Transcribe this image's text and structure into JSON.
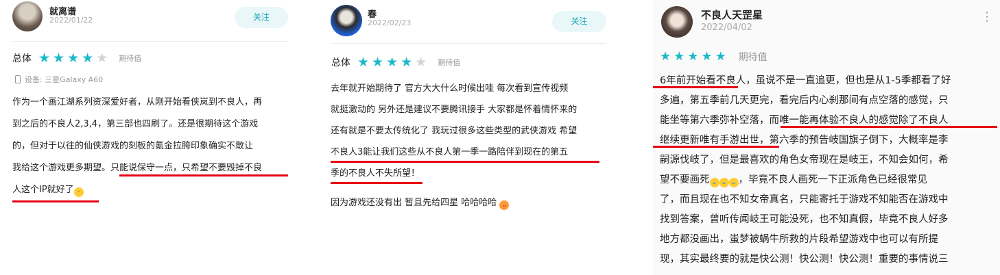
{
  "colors": {
    "star_filled": "#1cb9c8",
    "star_empty": "#d3d3d3",
    "follow_text": "#18a6b9",
    "underline": "#e60012"
  },
  "reviews": [
    {
      "user": "就离谱",
      "date": "2022/01/22",
      "follow_label": "关注",
      "rating_label": "总体",
      "stars_filled": 4,
      "stars_total": 5,
      "expect_label": "期待值",
      "device_icon": "phone-icon",
      "device": "设备: 三星Galaxy A60",
      "lines": [
        "作为一个画江湖系列资深爱好者，从刚开始看侠岚到不良人，再",
        "到之后的不良人2,3,4，第三部也四刷了。还是很期待这个游戏",
        "的，但对于以往的仙侠游戏的刻板的氪金拉胯印象确实不敢让",
        "我给这个游戏更多期望。只能说保守一点，只希望不要毁掉不良",
        "人这个IP就好了"
      ],
      "emoji": "grin-emoji"
    },
    {
      "user": "春",
      "date": "2022/02/23",
      "follow_label": "关注",
      "rating_label": "总体",
      "stars_filled": 4,
      "stars_total": 5,
      "expect_label": "期待值",
      "lines": [
        "去年就开始期待了 官方大大什么时候出哇 每次看到宣传视频",
        "就挺激动的 另外还是建议不要腾讯接手 大家都是怀着情怀来的",
        "还有就是不要太传统化了 我玩过很多这些类型的武侠游戏 希望",
        "不良人3能让我们这些从不良人第一季一路陪伴到现在的第五",
        "季的不良人不失所望！"
      ],
      "extra_line": "因为游戏还没有出 暂且先给四星 哈哈哈哈",
      "emoji": "tongue-emoji"
    },
    {
      "user": "不良人天罡星",
      "date": "2022/04/02",
      "rating_label": "",
      "stars_filled": 5,
      "stars_total": 5,
      "expect_label": "期待值",
      "lines": [
        "6年前开始看不良人，虽说不是一直追更，但也是从1-5季都看了好",
        "多遍，第五季前几天更完，看完后内心刹那间有点空落的感觉，只",
        "能坐等第六季弥补空落，而唯一能再体验不良人的感觉除了不良人",
        "继续更新唯有手游出世，第六季的预告岐国旗子倒下，大概率是李",
        "嗣源伐岐了，但是最喜欢的角色女帝现在是岐王，不知会如何，希",
        "望不要画死",
        "，毕竟不良人画死一下正派角色已经很常见",
        "了，而且现在也不知女帝真名，只能寄托于游戏不知能否在游戏中",
        "找到答案，曾听传闻岐王可能没死，也不知真假，毕竟不良人好多",
        "地方都没画出，蚩梦被蜗牛所救的片段希望游戏中也可以有所提",
        "现，其实最终要的就是快公测！快公测！快公测！重要的事情说三"
      ],
      "emoji": "crying-emoji"
    }
  ]
}
